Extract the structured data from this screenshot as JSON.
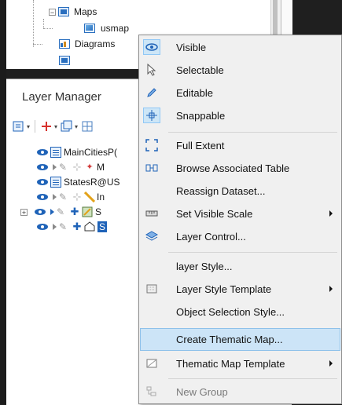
{
  "tree": {
    "items": [
      {
        "label": "Maps",
        "icon": "folder-icon"
      },
      {
        "label": "usmap",
        "icon": "map-icon"
      },
      {
        "label": "Diagrams",
        "icon": "diagram-icon"
      }
    ]
  },
  "layer_manager": {
    "title": "Layer Manager",
    "layers": [
      {
        "label": "MainCitiesP("
      },
      {
        "label": "M"
      },
      {
        "label": "StatesR@US"
      },
      {
        "label": "In"
      },
      {
        "label": "S"
      },
      {
        "label": "S"
      }
    ]
  },
  "context_menu": {
    "items": [
      {
        "label": "Visible",
        "icon": "eye-icon",
        "checked": true
      },
      {
        "label": "Selectable",
        "icon": "cursor-icon"
      },
      {
        "label": "Editable",
        "icon": "pencil-icon"
      },
      {
        "label": "Snappable",
        "icon": "snap-icon",
        "checked": true
      },
      {
        "label": "Full Extent",
        "icon": "full-extent-icon"
      },
      {
        "label": "Browse Associated Table",
        "icon": "table-icon"
      },
      {
        "label": "Reassign Dataset..."
      },
      {
        "label": "Set Visible Scale",
        "icon": "scale-icon",
        "submenu": true
      },
      {
        "label": "Layer Control...",
        "icon": "layers-icon"
      },
      {
        "label": "layer Style..."
      },
      {
        "label": "Layer Style Template",
        "icon": "style-template-icon",
        "submenu": true
      },
      {
        "label": "Object Selection Style..."
      },
      {
        "label": "Create Thematic Map...",
        "highlighted": true
      },
      {
        "label": "Thematic Map Template",
        "icon": "thematic-template-icon",
        "submenu": true
      },
      {
        "label": "New Group",
        "icon": "new-group-icon",
        "disabled": true
      }
    ]
  },
  "colors": {
    "accent": "#1f63b8",
    "menu_highlight": "#cce4f7",
    "window_bg": "#1f1f1f"
  }
}
